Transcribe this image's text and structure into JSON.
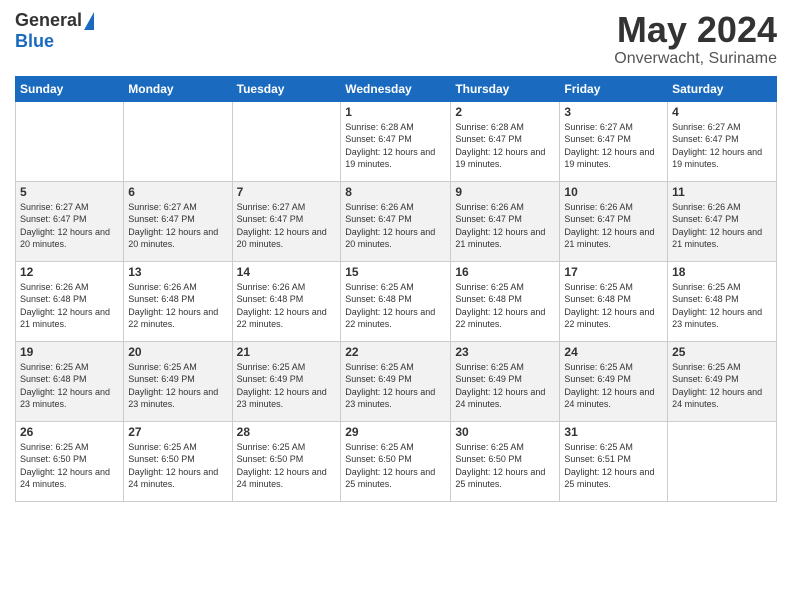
{
  "header": {
    "logo_general": "General",
    "logo_blue": "Blue",
    "title": "May 2024",
    "location": "Onverwacht, Suriname"
  },
  "days_of_week": [
    "Sunday",
    "Monday",
    "Tuesday",
    "Wednesday",
    "Thursday",
    "Friday",
    "Saturday"
  ],
  "weeks": [
    {
      "days": [
        {
          "num": "",
          "sunrise": "",
          "sunset": "",
          "daylight": ""
        },
        {
          "num": "",
          "sunrise": "",
          "sunset": "",
          "daylight": ""
        },
        {
          "num": "",
          "sunrise": "",
          "sunset": "",
          "daylight": ""
        },
        {
          "num": "1",
          "sunrise": "Sunrise: 6:28 AM",
          "sunset": "Sunset: 6:47 PM",
          "daylight": "Daylight: 12 hours and 19 minutes."
        },
        {
          "num": "2",
          "sunrise": "Sunrise: 6:28 AM",
          "sunset": "Sunset: 6:47 PM",
          "daylight": "Daylight: 12 hours and 19 minutes."
        },
        {
          "num": "3",
          "sunrise": "Sunrise: 6:27 AM",
          "sunset": "Sunset: 6:47 PM",
          "daylight": "Daylight: 12 hours and 19 minutes."
        },
        {
          "num": "4",
          "sunrise": "Sunrise: 6:27 AM",
          "sunset": "Sunset: 6:47 PM",
          "daylight": "Daylight: 12 hours and 19 minutes."
        }
      ]
    },
    {
      "days": [
        {
          "num": "5",
          "sunrise": "Sunrise: 6:27 AM",
          "sunset": "Sunset: 6:47 PM",
          "daylight": "Daylight: 12 hours and 20 minutes."
        },
        {
          "num": "6",
          "sunrise": "Sunrise: 6:27 AM",
          "sunset": "Sunset: 6:47 PM",
          "daylight": "Daylight: 12 hours and 20 minutes."
        },
        {
          "num": "7",
          "sunrise": "Sunrise: 6:27 AM",
          "sunset": "Sunset: 6:47 PM",
          "daylight": "Daylight: 12 hours and 20 minutes."
        },
        {
          "num": "8",
          "sunrise": "Sunrise: 6:26 AM",
          "sunset": "Sunset: 6:47 PM",
          "daylight": "Daylight: 12 hours and 20 minutes."
        },
        {
          "num": "9",
          "sunrise": "Sunrise: 6:26 AM",
          "sunset": "Sunset: 6:47 PM",
          "daylight": "Daylight: 12 hours and 21 minutes."
        },
        {
          "num": "10",
          "sunrise": "Sunrise: 6:26 AM",
          "sunset": "Sunset: 6:47 PM",
          "daylight": "Daylight: 12 hours and 21 minutes."
        },
        {
          "num": "11",
          "sunrise": "Sunrise: 6:26 AM",
          "sunset": "Sunset: 6:47 PM",
          "daylight": "Daylight: 12 hours and 21 minutes."
        }
      ]
    },
    {
      "days": [
        {
          "num": "12",
          "sunrise": "Sunrise: 6:26 AM",
          "sunset": "Sunset: 6:48 PM",
          "daylight": "Daylight: 12 hours and 21 minutes."
        },
        {
          "num": "13",
          "sunrise": "Sunrise: 6:26 AM",
          "sunset": "Sunset: 6:48 PM",
          "daylight": "Daylight: 12 hours and 22 minutes."
        },
        {
          "num": "14",
          "sunrise": "Sunrise: 6:26 AM",
          "sunset": "Sunset: 6:48 PM",
          "daylight": "Daylight: 12 hours and 22 minutes."
        },
        {
          "num": "15",
          "sunrise": "Sunrise: 6:25 AM",
          "sunset": "Sunset: 6:48 PM",
          "daylight": "Daylight: 12 hours and 22 minutes."
        },
        {
          "num": "16",
          "sunrise": "Sunrise: 6:25 AM",
          "sunset": "Sunset: 6:48 PM",
          "daylight": "Daylight: 12 hours and 22 minutes."
        },
        {
          "num": "17",
          "sunrise": "Sunrise: 6:25 AM",
          "sunset": "Sunset: 6:48 PM",
          "daylight": "Daylight: 12 hours and 22 minutes."
        },
        {
          "num": "18",
          "sunrise": "Sunrise: 6:25 AM",
          "sunset": "Sunset: 6:48 PM",
          "daylight": "Daylight: 12 hours and 23 minutes."
        }
      ]
    },
    {
      "days": [
        {
          "num": "19",
          "sunrise": "Sunrise: 6:25 AM",
          "sunset": "Sunset: 6:48 PM",
          "daylight": "Daylight: 12 hours and 23 minutes."
        },
        {
          "num": "20",
          "sunrise": "Sunrise: 6:25 AM",
          "sunset": "Sunset: 6:49 PM",
          "daylight": "Daylight: 12 hours and 23 minutes."
        },
        {
          "num": "21",
          "sunrise": "Sunrise: 6:25 AM",
          "sunset": "Sunset: 6:49 PM",
          "daylight": "Daylight: 12 hours and 23 minutes."
        },
        {
          "num": "22",
          "sunrise": "Sunrise: 6:25 AM",
          "sunset": "Sunset: 6:49 PM",
          "daylight": "Daylight: 12 hours and 23 minutes."
        },
        {
          "num": "23",
          "sunrise": "Sunrise: 6:25 AM",
          "sunset": "Sunset: 6:49 PM",
          "daylight": "Daylight: 12 hours and 24 minutes."
        },
        {
          "num": "24",
          "sunrise": "Sunrise: 6:25 AM",
          "sunset": "Sunset: 6:49 PM",
          "daylight": "Daylight: 12 hours and 24 minutes."
        },
        {
          "num": "25",
          "sunrise": "Sunrise: 6:25 AM",
          "sunset": "Sunset: 6:49 PM",
          "daylight": "Daylight: 12 hours and 24 minutes."
        }
      ]
    },
    {
      "days": [
        {
          "num": "26",
          "sunrise": "Sunrise: 6:25 AM",
          "sunset": "Sunset: 6:50 PM",
          "daylight": "Daylight: 12 hours and 24 minutes."
        },
        {
          "num": "27",
          "sunrise": "Sunrise: 6:25 AM",
          "sunset": "Sunset: 6:50 PM",
          "daylight": "Daylight: 12 hours and 24 minutes."
        },
        {
          "num": "28",
          "sunrise": "Sunrise: 6:25 AM",
          "sunset": "Sunset: 6:50 PM",
          "daylight": "Daylight: 12 hours and 24 minutes."
        },
        {
          "num": "29",
          "sunrise": "Sunrise: 6:25 AM",
          "sunset": "Sunset: 6:50 PM",
          "daylight": "Daylight: 12 hours and 25 minutes."
        },
        {
          "num": "30",
          "sunrise": "Sunrise: 6:25 AM",
          "sunset": "Sunset: 6:50 PM",
          "daylight": "Daylight: 12 hours and 25 minutes."
        },
        {
          "num": "31",
          "sunrise": "Sunrise: 6:25 AM",
          "sunset": "Sunset: 6:51 PM",
          "daylight": "Daylight: 12 hours and 25 minutes."
        },
        {
          "num": "",
          "sunrise": "",
          "sunset": "",
          "daylight": ""
        }
      ]
    }
  ]
}
